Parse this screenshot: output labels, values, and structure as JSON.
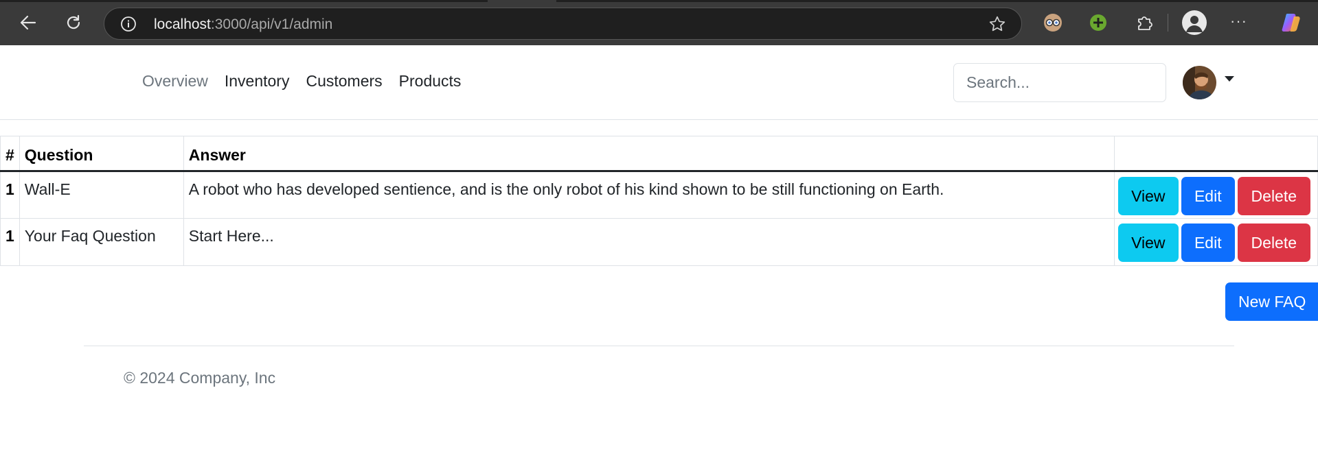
{
  "browser": {
    "url_host": "localhost",
    "url_path": ":3000/api/v1/admin",
    "more_label": "···"
  },
  "navbar": {
    "links": [
      {
        "label": "Overview",
        "muted": true
      },
      {
        "label": "Inventory"
      },
      {
        "label": "Customers"
      },
      {
        "label": "Products"
      }
    ],
    "search_placeholder": "Search..."
  },
  "table": {
    "headers": [
      "#",
      "Question",
      "Answer",
      ""
    ],
    "rows": [
      {
        "num": "1",
        "question": "Wall-E",
        "answer": "A robot who has developed sentience, and is the only robot of his kind shown to be still functioning on Earth."
      },
      {
        "num": "1",
        "question": "Your Faq Question",
        "answer": "Start Here..."
      }
    ],
    "actions": {
      "view": "View",
      "edit": "Edit",
      "delete": "Delete"
    }
  },
  "new_faq_label": "New FAQ",
  "footer": {
    "text": "© 2024 Company, Inc"
  },
  "colors": {
    "info": "#0dcaf0",
    "primary": "#0d6efd",
    "danger": "#dc3545",
    "muted": "#6c757d"
  }
}
